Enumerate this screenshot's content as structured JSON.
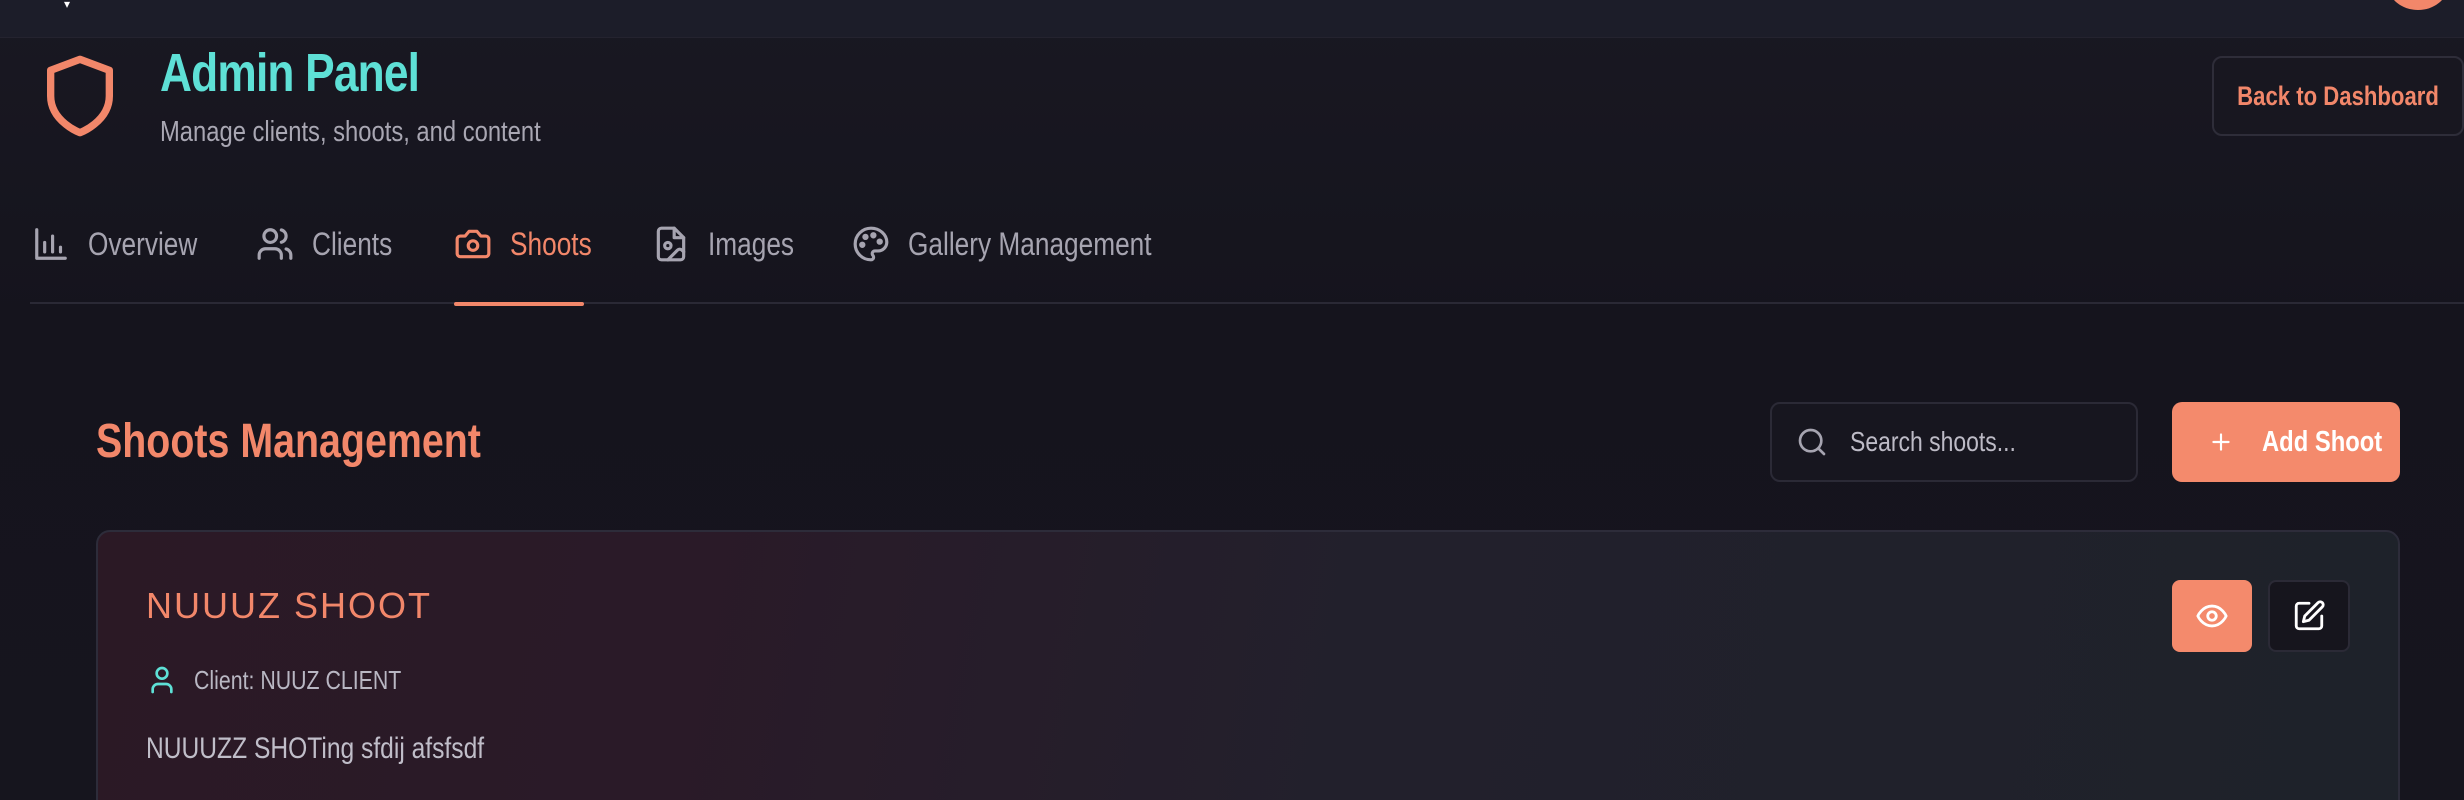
{
  "header": {
    "title": "Admin Panel",
    "subtitle": "Manage clients, shoots, and content",
    "back_button": "Back to Dashboard"
  },
  "tabs": [
    {
      "label": "Overview",
      "icon": "bar-chart-icon",
      "active": false
    },
    {
      "label": "Clients",
      "icon": "users-icon",
      "active": false
    },
    {
      "label": "Shoots",
      "icon": "camera-icon",
      "active": true
    },
    {
      "label": "Images",
      "icon": "image-file-icon",
      "active": false
    },
    {
      "label": "Gallery Management",
      "icon": "palette-icon",
      "active": false
    }
  ],
  "section": {
    "title": "Shoots Management",
    "search_placeholder": "Search shoots...",
    "add_button": "Add Shoot"
  },
  "shoot": {
    "title": "NUUUZ SHOOT",
    "client": "Client: NUUZ CLIENT",
    "description": "NUUUZZ SHOTing sfdij afsfsdf"
  },
  "colors": {
    "accent": "#f2876a",
    "title_teal": "#5ee0d6",
    "background": "#15141d"
  }
}
